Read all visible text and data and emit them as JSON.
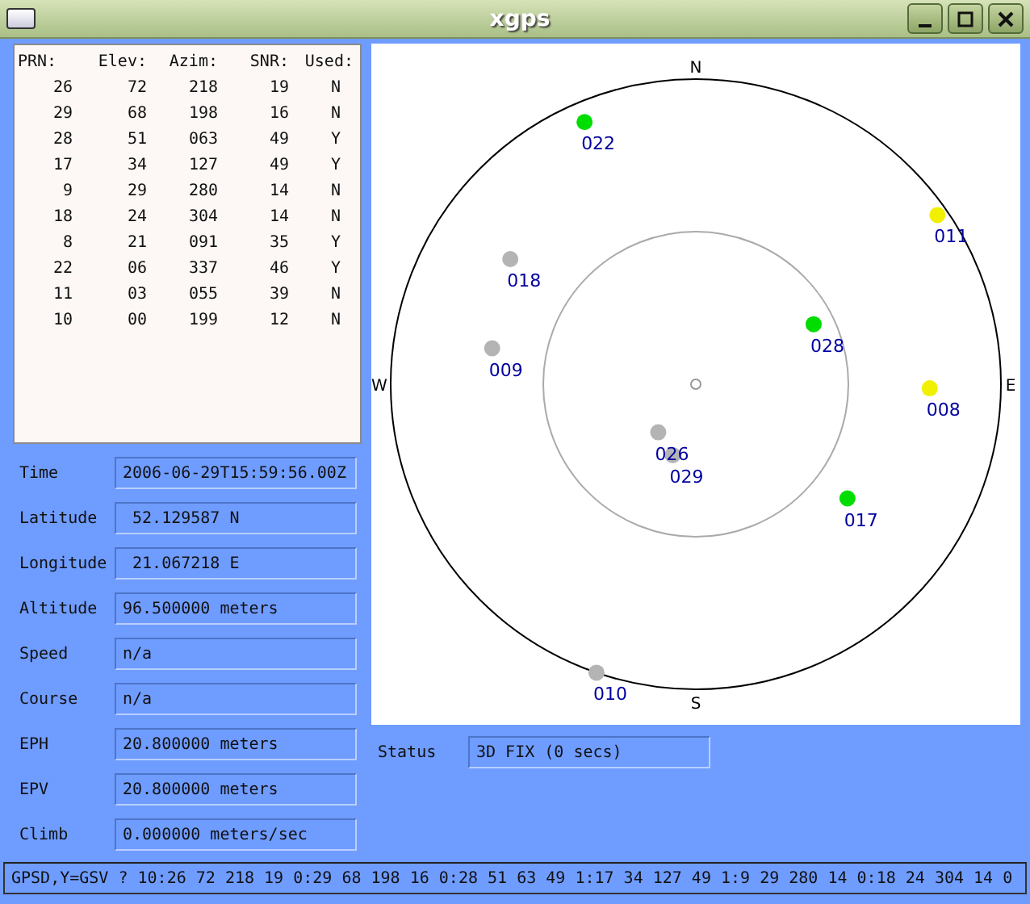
{
  "window": {
    "title": "xgps"
  },
  "satellite_table": {
    "columns": [
      "PRN:",
      "Elev:",
      "Azim:",
      "SNR:",
      "Used:"
    ],
    "rows": [
      {
        "prn": "26",
        "elev": "72",
        "azim": "218",
        "snr": "19",
        "used": "N",
        "sky_label": "026",
        "color": "#b4b4b4"
      },
      {
        "prn": "29",
        "elev": "68",
        "azim": "198",
        "snr": "16",
        "used": "N",
        "sky_label": "029",
        "color": "#b4b4b4"
      },
      {
        "prn": "28",
        "elev": "51",
        "azim": "063",
        "snr": "49",
        "used": "Y",
        "sky_label": "028",
        "color": "#00dd00"
      },
      {
        "prn": "17",
        "elev": "34",
        "azim": "127",
        "snr": "49",
        "used": "Y",
        "sky_label": "017",
        "color": "#00dd00"
      },
      {
        "prn": "9",
        "elev": "29",
        "azim": "280",
        "snr": "14",
        "used": "N",
        "sky_label": "009",
        "color": "#b4b4b4"
      },
      {
        "prn": "18",
        "elev": "24",
        "azim": "304",
        "snr": "14",
        "used": "N",
        "sky_label": "018",
        "color": "#b4b4b4"
      },
      {
        "prn": "8",
        "elev": "21",
        "azim": "091",
        "snr": "35",
        "used": "Y",
        "sky_label": "008",
        "color": "#f0f000"
      },
      {
        "prn": "22",
        "elev": "06",
        "azim": "337",
        "snr": "46",
        "used": "Y",
        "sky_label": "022",
        "color": "#00dd00"
      },
      {
        "prn": "11",
        "elev": "03",
        "azim": "055",
        "snr": "39",
        "used": "N",
        "sky_label": "011",
        "color": "#f0f000"
      },
      {
        "prn": "10",
        "elev": "00",
        "azim": "199",
        "snr": "12",
        "used": "N",
        "sky_label": "010",
        "color": "#b4b4b4"
      }
    ]
  },
  "fields": [
    {
      "label": "Time",
      "value": "2006-06-29T15:59:56.00Z"
    },
    {
      "label": "Latitude",
      "value": " 52.129587 N"
    },
    {
      "label": "Longitude",
      "value": " 21.067218 E"
    },
    {
      "label": "Altitude",
      "value": "96.500000 meters"
    },
    {
      "label": "Speed",
      "value": "n/a"
    },
    {
      "label": "Course",
      "value": "n/a"
    },
    {
      "label": "EPH",
      "value": "20.800000 meters"
    },
    {
      "label": "EPV",
      "value": "20.800000 meters"
    },
    {
      "label": "Climb",
      "value": "0.000000 meters/sec"
    }
  ],
  "sky_view": {
    "compass": [
      "N",
      "E",
      "S",
      "W"
    ]
  },
  "status": {
    "label": "Status",
    "value": "3D FIX (0 secs)"
  },
  "status_bar": "GPSD,Y=GSV ? 10:26 72 218 19 0:29 68 198 16 0:28 51 63 49 1:17 34 127 49 1:9 29 280 14 0:18 24 304 14 0"
}
